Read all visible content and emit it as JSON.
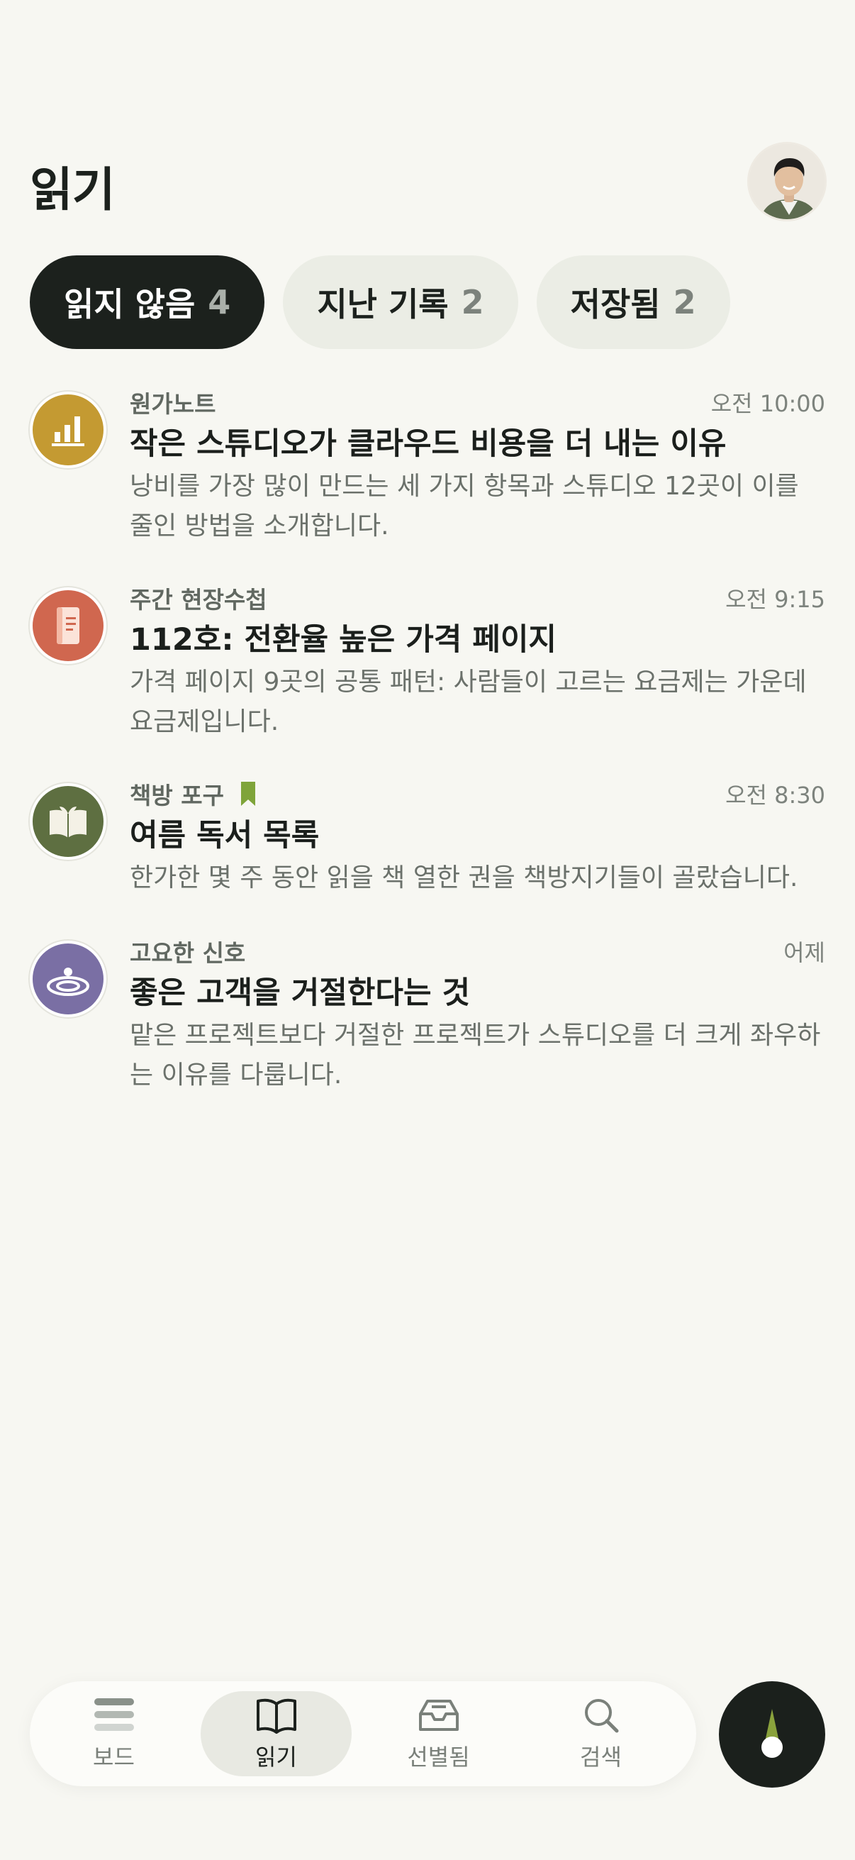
{
  "header": {
    "title": "읽기"
  },
  "tabs": [
    {
      "label": "읽지 않음",
      "count": "4"
    },
    {
      "label": "지난 기록",
      "count": "2"
    },
    {
      "label": "저장됨",
      "count": "2"
    }
  ],
  "items": [
    {
      "source": "원가노트",
      "time": "오전 10:00",
      "headline": "작은 스튜디오가 클라우드 비용을 더 내는 이유",
      "summary": "낭비를 가장 많이 만드는 세 가지 항목과 스튜디오 12곳이 이를 줄인 방법을 소개합니다.",
      "icon": "bar-chart-icon",
      "color": "#c49a32"
    },
    {
      "source": "주간 현장수첩",
      "time": "오전 9:15",
      "headline": "112호: 전환율 높은 가격 페이지",
      "summary": "가격 페이지 9곳의 공통 패턴: 사람들이 고르는 요금제는 가운데 요금제입니다.",
      "icon": "notebook-icon",
      "color": "#d0674f"
    },
    {
      "source": "책방 포구",
      "time": "오전 8:30",
      "headline": "여름 독서 목록",
      "summary": "한가한 몇 주 동안 읽을 책 열한 권을 책방지기들이 골랐습니다.",
      "icon": "open-book-icon",
      "color": "#5e6f41",
      "saved": true
    },
    {
      "source": "고요한 신호",
      "time": "어제",
      "headline": "좋은 고객을 거절한다는 것",
      "summary": "맡은 프로젝트보다 거절한 프로젝트가 스튜디오를 더 크게 좌우하는 이유를 다룹니다.",
      "icon": "ripple-icon",
      "color": "#7a6fa4"
    }
  ],
  "nav": [
    {
      "label": "보드",
      "icon": "stack-icon"
    },
    {
      "label": "읽기",
      "icon": "book-icon",
      "active": true
    },
    {
      "label": "선별됨",
      "icon": "inbox-icon"
    },
    {
      "label": "검색",
      "icon": "search-icon"
    }
  ],
  "colors": {
    "accent_dark": "#1c211d",
    "saved_marker": "#7fa43a",
    "background": "#f7f7f2"
  }
}
